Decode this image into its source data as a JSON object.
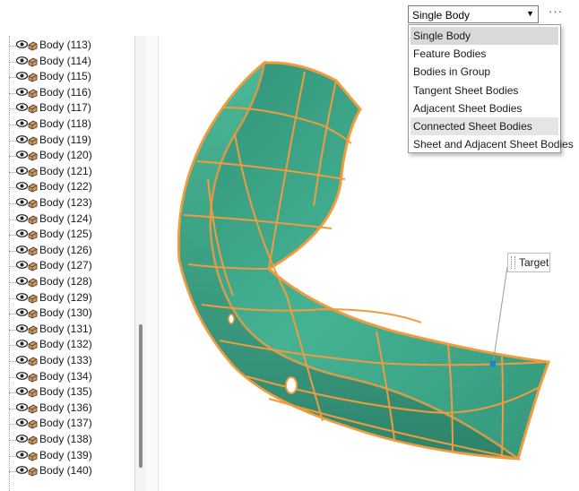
{
  "tree": {
    "items": [
      {
        "label": "Body (113)"
      },
      {
        "label": "Body (114)"
      },
      {
        "label": "Body (115)"
      },
      {
        "label": "Body (116)"
      },
      {
        "label": "Body (117)"
      },
      {
        "label": "Body (118)"
      },
      {
        "label": "Body (119)"
      },
      {
        "label": "Body (120)"
      },
      {
        "label": "Body (121)"
      },
      {
        "label": "Body (122)"
      },
      {
        "label": "Body (123)"
      },
      {
        "label": "Body (124)"
      },
      {
        "label": "Body (125)"
      },
      {
        "label": "Body (126)"
      },
      {
        "label": "Body (127)"
      },
      {
        "label": "Body (128)"
      },
      {
        "label": "Body (129)"
      },
      {
        "label": "Body (130)"
      },
      {
        "label": "Body (131)"
      },
      {
        "label": "Body (132)"
      },
      {
        "label": "Body (133)"
      },
      {
        "label": "Body (134)"
      },
      {
        "label": "Body (135)"
      },
      {
        "label": "Body (136)"
      },
      {
        "label": "Body (137)"
      },
      {
        "label": "Body (138)"
      },
      {
        "label": "Body (139)"
      },
      {
        "label": "Body (140)"
      }
    ],
    "row_icons": [
      "eye-icon",
      "body-icon"
    ]
  },
  "selection_filter": {
    "value": "Single Body",
    "more_label": "···",
    "options": [
      {
        "label": "Single Body"
      },
      {
        "label": "Feature Bodies"
      },
      {
        "label": "Bodies in Group"
      },
      {
        "label": "Tangent Sheet Bodies"
      },
      {
        "label": "Adjacent Sheet Bodies"
      },
      {
        "label": "Connected Sheet Bodies"
      },
      {
        "label": "Sheet and Adjacent Sheet Bodies"
      }
    ]
  },
  "viewport": {
    "target_label": "Target",
    "colors": {
      "surface": "#3aa88a",
      "edge": "#f29b3c",
      "target_point": "#1f7fd6"
    }
  }
}
